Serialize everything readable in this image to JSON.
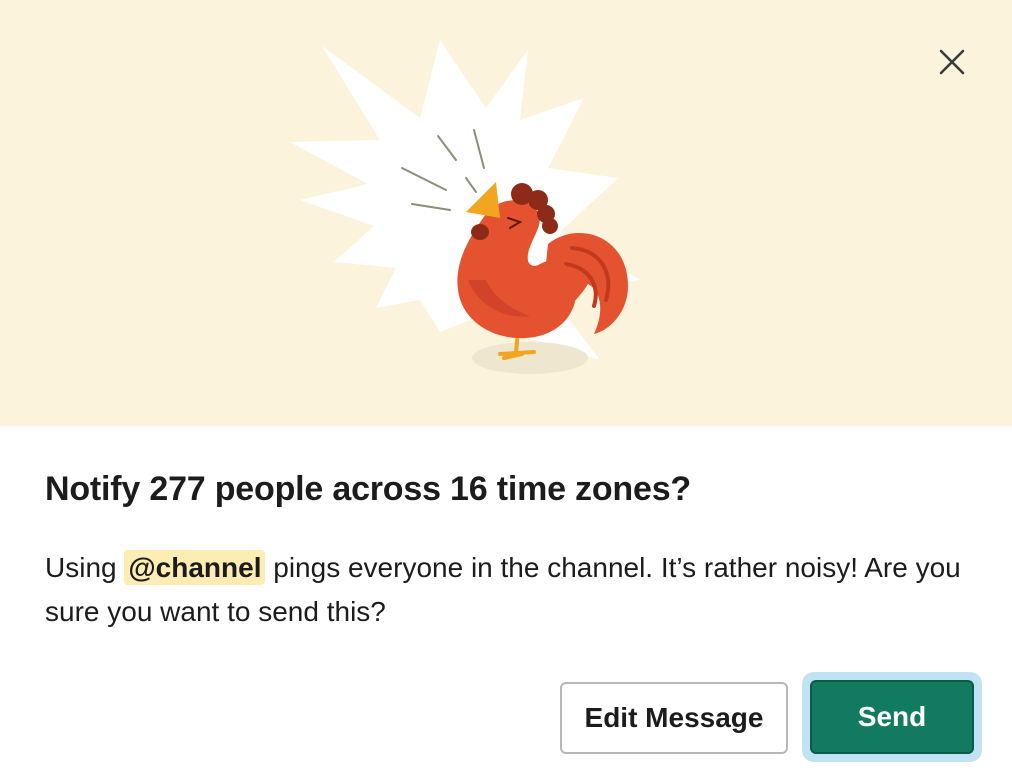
{
  "dialog": {
    "close_label": "Close",
    "title": "Notify 277 people across 16 time zones?",
    "body": {
      "prefix": "Using ",
      "mention": "@channel",
      "suffix": " pings everyone in the channel. It’s rather noisy! Are you sure you want to send this?"
    },
    "buttons": {
      "edit": "Edit Message",
      "send": "Send"
    }
  },
  "colors": {
    "hero_background": "#fcf3dc",
    "send_button": "#127b5f",
    "send_focus_ring": "#bfe3f3",
    "mention_highlight": "#fdecb3",
    "rooster_body": "#e4522f"
  },
  "icons": [
    "close-icon",
    "rooster-illustration"
  ]
}
